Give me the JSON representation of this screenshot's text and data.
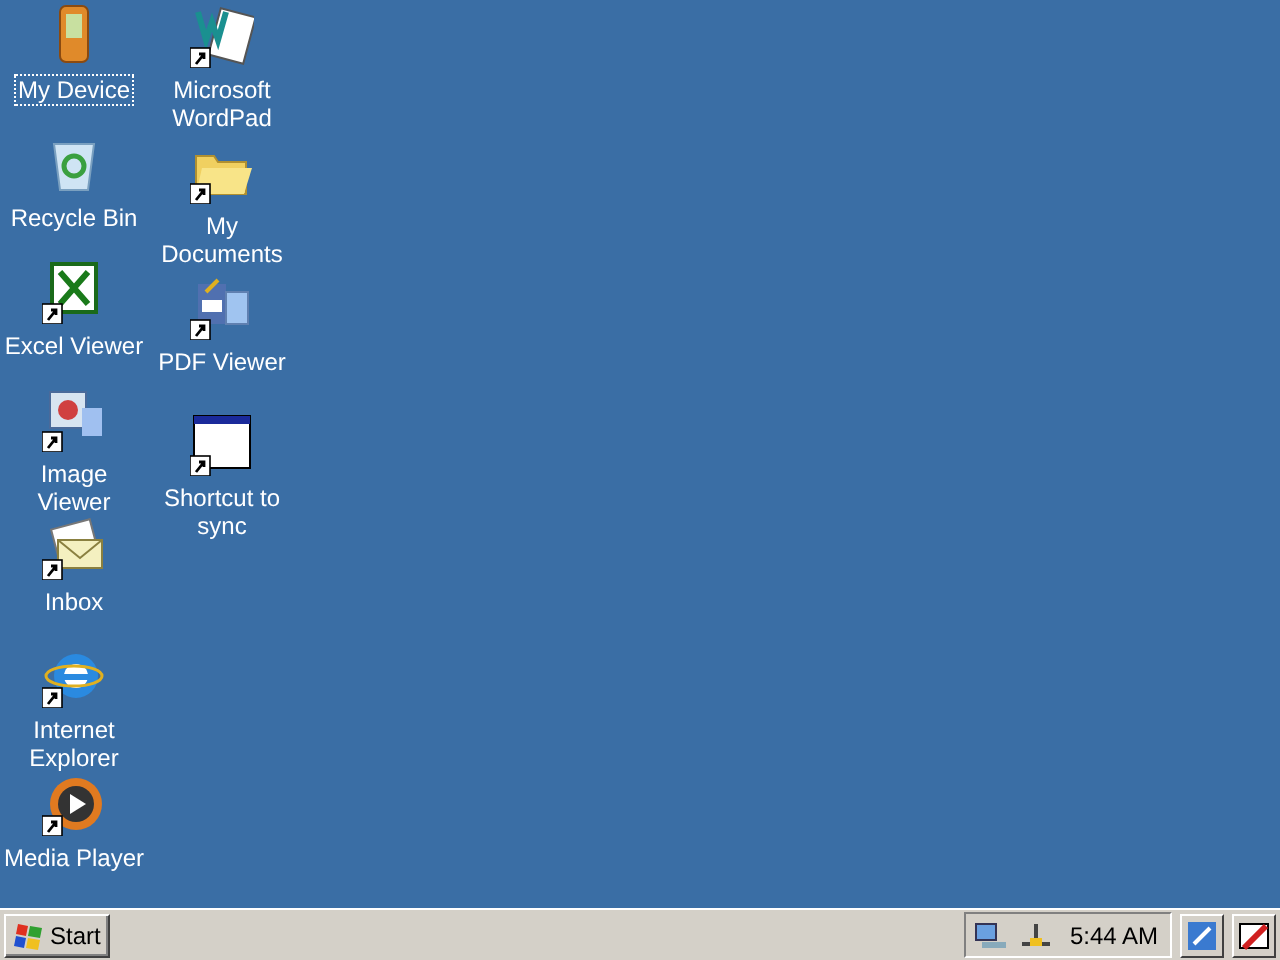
{
  "desktop": {
    "columns": [
      [
        {
          "kind": "device",
          "label": "My Device",
          "shortcut": false,
          "selected": true
        },
        {
          "kind": "recycle",
          "label": "Recycle Bin",
          "shortcut": false,
          "selected": false
        },
        {
          "kind": "excel",
          "label": "Excel Viewer",
          "shortcut": true,
          "selected": false
        },
        {
          "kind": "image",
          "label": "Image Viewer",
          "shortcut": true,
          "selected": false
        },
        {
          "kind": "inbox",
          "label": "Inbox",
          "shortcut": true,
          "selected": false
        },
        {
          "kind": "ie",
          "label": "Internet Explorer",
          "shortcut": true,
          "selected": false
        },
        {
          "kind": "media",
          "label": "Media Player",
          "shortcut": true,
          "selected": false
        }
      ],
      [
        {
          "kind": "wordpad",
          "label": "Microsoft WordPad",
          "shortcut": true,
          "selected": false
        },
        {
          "kind": "folder",
          "label": "My Documents",
          "shortcut": true,
          "selected": false
        },
        {
          "kind": "pdf",
          "label": "PDF Viewer",
          "shortcut": true,
          "selected": false
        },
        {
          "kind": "window",
          "label": "Shortcut to sync",
          "shortcut": true,
          "selected": false
        }
      ]
    ]
  },
  "taskbar": {
    "start_label": "Start",
    "clock": "5:44 AM"
  }
}
